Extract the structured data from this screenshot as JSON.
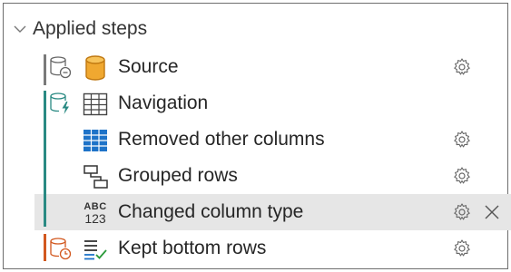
{
  "panel": {
    "title": "Applied steps"
  },
  "steps": [
    {
      "label": "Source",
      "has_settings": true
    },
    {
      "label": "Navigation",
      "has_settings": false
    },
    {
      "label": "Removed other columns",
      "has_settings": true
    },
    {
      "label": "Grouped rows",
      "has_settings": true
    },
    {
      "label": "Changed column type",
      "has_settings": true,
      "selected": true,
      "deletable": true
    },
    {
      "label": "Kept bottom rows",
      "has_settings": true
    }
  ],
  "icons": {
    "type_icon_top": "ABC",
    "type_icon_bottom": "123"
  },
  "colors": {
    "gray_bar": "#7a7a7a",
    "teal_bar": "#2a8a83",
    "orange_bar": "#d2581f",
    "source_db": "#f0a830",
    "grid_blue": "#1e73c8",
    "selected_bg": "#e6e6e6"
  }
}
